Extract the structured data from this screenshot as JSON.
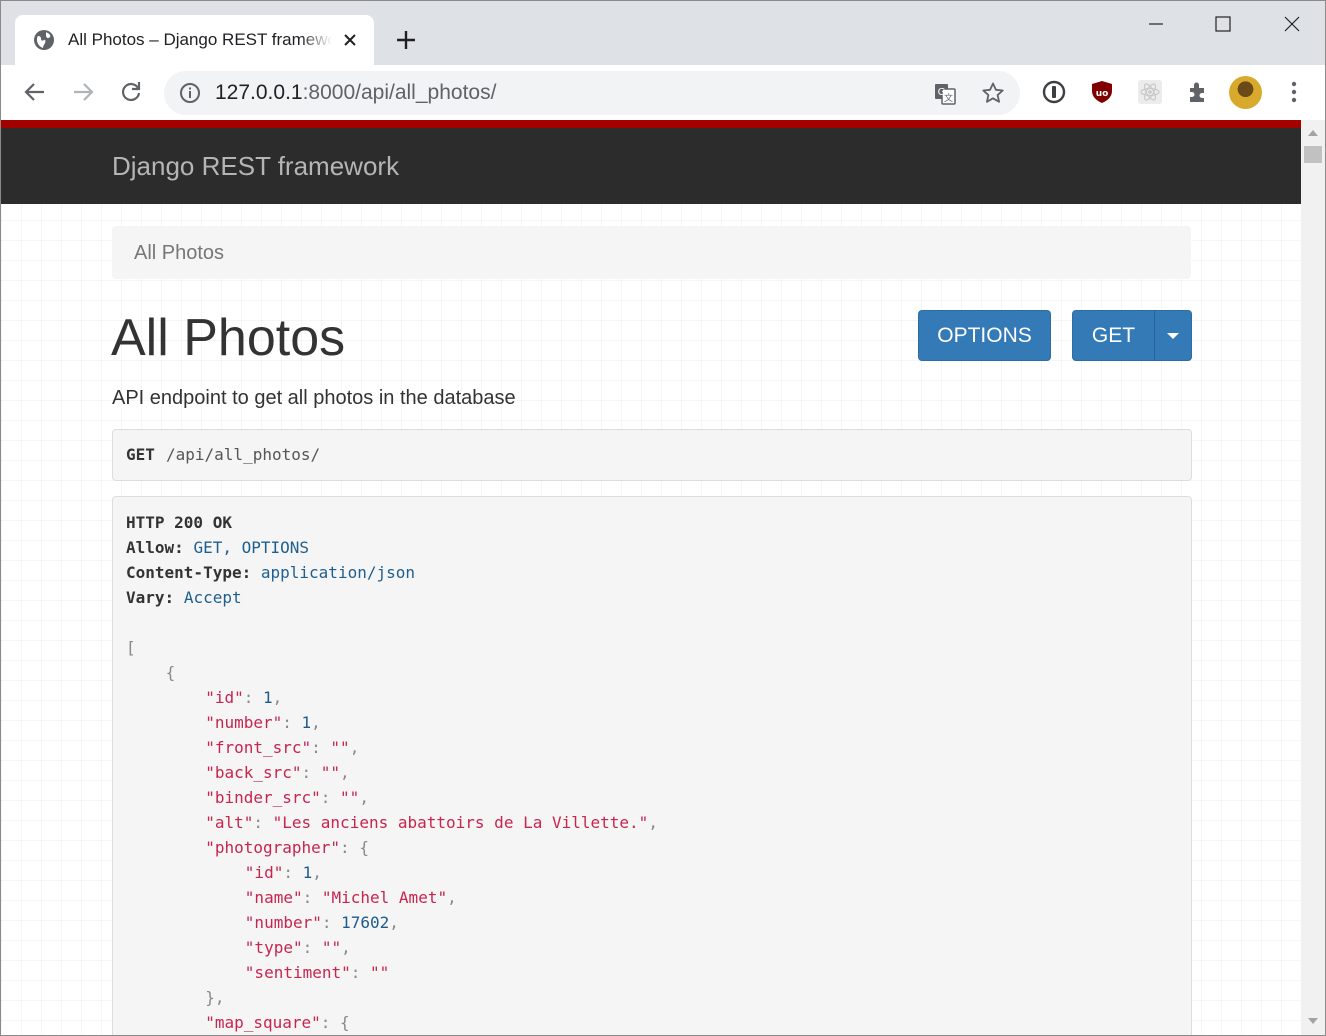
{
  "browser": {
    "tab_title": "All Photos – Django REST framework",
    "url_host": "127.0.0.1",
    "url_rest": ":8000/api/all_photos/"
  },
  "page": {
    "brand": "Django REST framework",
    "breadcrumb": "All Photos",
    "title": "All Photos",
    "options_label": "OPTIONS",
    "get_label": "GET",
    "description": "API endpoint to get all photos in the database",
    "request_method": "GET",
    "request_path": "/api/all_photos/"
  },
  "response": {
    "status": "HTTP 200 OK",
    "headers": [
      {
        "name": "Allow:",
        "value": "GET, OPTIONS"
      },
      {
        "name": "Content-Type:",
        "value": "application/json"
      },
      {
        "name": "Vary:",
        "value": "Accept"
      }
    ],
    "body_lines": [
      {
        "indent": 0,
        "tokens": [
          {
            "t": "[",
            "c": "pun"
          }
        ]
      },
      {
        "indent": 1,
        "tokens": [
          {
            "t": "{",
            "c": "pun"
          }
        ]
      },
      {
        "indent": 2,
        "tokens": [
          {
            "t": "\"id\"",
            "c": "key"
          },
          {
            "t": ": ",
            "c": "pun"
          },
          {
            "t": "1",
            "c": "num"
          },
          {
            "t": ",",
            "c": "pun"
          }
        ]
      },
      {
        "indent": 2,
        "tokens": [
          {
            "t": "\"number\"",
            "c": "key"
          },
          {
            "t": ": ",
            "c": "pun"
          },
          {
            "t": "1",
            "c": "num"
          },
          {
            "t": ",",
            "c": "pun"
          }
        ]
      },
      {
        "indent": 2,
        "tokens": [
          {
            "t": "\"front_src\"",
            "c": "key"
          },
          {
            "t": ": ",
            "c": "pun"
          },
          {
            "t": "\"\"",
            "c": "str"
          },
          {
            "t": ",",
            "c": "pun"
          }
        ]
      },
      {
        "indent": 2,
        "tokens": [
          {
            "t": "\"back_src\"",
            "c": "key"
          },
          {
            "t": ": ",
            "c": "pun"
          },
          {
            "t": "\"\"",
            "c": "str"
          },
          {
            "t": ",",
            "c": "pun"
          }
        ]
      },
      {
        "indent": 2,
        "tokens": [
          {
            "t": "\"binder_src\"",
            "c": "key"
          },
          {
            "t": ": ",
            "c": "pun"
          },
          {
            "t": "\"\"",
            "c": "str"
          },
          {
            "t": ",",
            "c": "pun"
          }
        ]
      },
      {
        "indent": 2,
        "tokens": [
          {
            "t": "\"alt\"",
            "c": "key"
          },
          {
            "t": ": ",
            "c": "pun"
          },
          {
            "t": "\"Les anciens abattoirs de La Villette.\"",
            "c": "str"
          },
          {
            "t": ",",
            "c": "pun"
          }
        ]
      },
      {
        "indent": 2,
        "tokens": [
          {
            "t": "\"photographer\"",
            "c": "key"
          },
          {
            "t": ": {",
            "c": "pun"
          }
        ]
      },
      {
        "indent": 3,
        "tokens": [
          {
            "t": "\"id\"",
            "c": "key"
          },
          {
            "t": ": ",
            "c": "pun"
          },
          {
            "t": "1",
            "c": "num"
          },
          {
            "t": ",",
            "c": "pun"
          }
        ]
      },
      {
        "indent": 3,
        "tokens": [
          {
            "t": "\"name\"",
            "c": "key"
          },
          {
            "t": ": ",
            "c": "pun"
          },
          {
            "t": "\"Michel Amet\"",
            "c": "str"
          },
          {
            "t": ",",
            "c": "pun"
          }
        ]
      },
      {
        "indent": 3,
        "tokens": [
          {
            "t": "\"number\"",
            "c": "key"
          },
          {
            "t": ": ",
            "c": "pun"
          },
          {
            "t": "17602",
            "c": "num"
          },
          {
            "t": ",",
            "c": "pun"
          }
        ]
      },
      {
        "indent": 3,
        "tokens": [
          {
            "t": "\"type\"",
            "c": "key"
          },
          {
            "t": ": ",
            "c": "pun"
          },
          {
            "t": "\"\"",
            "c": "str"
          },
          {
            "t": ",",
            "c": "pun"
          }
        ]
      },
      {
        "indent": 3,
        "tokens": [
          {
            "t": "\"sentiment\"",
            "c": "key"
          },
          {
            "t": ": ",
            "c": "pun"
          },
          {
            "t": "\"\"",
            "c": "str"
          }
        ]
      },
      {
        "indent": 2,
        "tokens": [
          {
            "t": "},",
            "c": "pun"
          }
        ]
      },
      {
        "indent": 2,
        "tokens": [
          {
            "t": "\"map_square\"",
            "c": "key"
          },
          {
            "t": ": {",
            "c": "pun"
          }
        ]
      }
    ]
  },
  "colors": {
    "accent": "#337ab7",
    "navbar": "#2c2c2c",
    "top_rule": "#a30000",
    "json_key": "#c7254e",
    "json_number": "#1d5b8f"
  }
}
